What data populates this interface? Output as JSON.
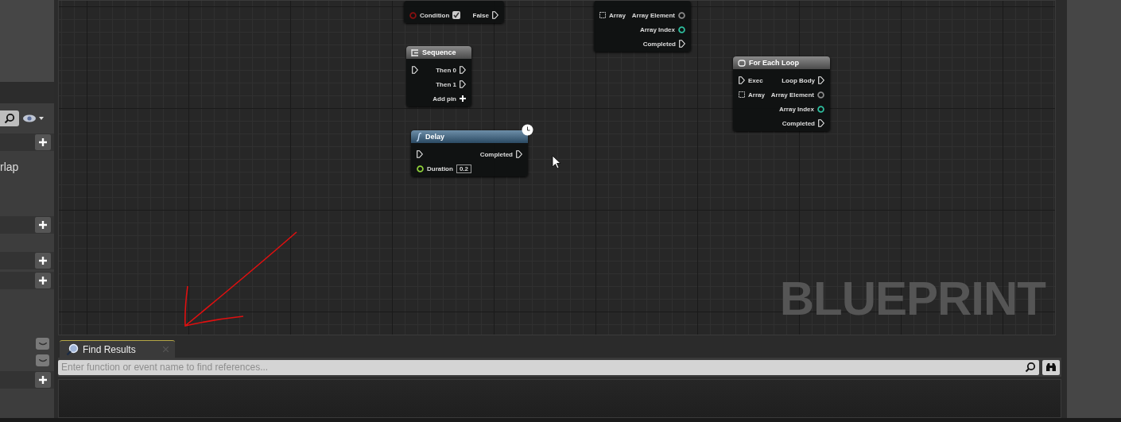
{
  "sidebar": {
    "text": "rlap"
  },
  "graph": {
    "label": "BLUEPRINT",
    "nodes": [
      {
        "kind": "plain",
        "rows": [
          {
            "in": {
              "kind": "data",
              "label": "Condition",
              "color": "#8a1010",
              "checked": true
            },
            "out": {
              "kind": "exec",
              "label": "False"
            }
          }
        ]
      },
      {
        "kind": "plain",
        "rows": [
          {
            "in": {
              "kind": "array",
              "label": "Array"
            },
            "out": {
              "kind": "data",
              "label": "Array Element",
              "color": "#8a8a8a"
            }
          },
          {
            "in": null,
            "out": {
              "kind": "data",
              "label": "Array Index",
              "color": "#2fc0a0"
            }
          },
          {
            "in": null,
            "out": {
              "kind": "exec",
              "label": "Completed"
            }
          }
        ]
      },
      {
        "kind": "sequence",
        "title": "Sequence",
        "rows": [
          {
            "in": {
              "kind": "exec"
            },
            "out": {
              "kind": "exec",
              "label": "Then 0"
            }
          },
          {
            "in": null,
            "out": {
              "kind": "exec",
              "label": "Then 1"
            }
          },
          {
            "in": null,
            "out": {
              "kind": "add",
              "label": "Add pin"
            }
          }
        ]
      },
      {
        "kind": "function",
        "title": "Delay",
        "latent": true,
        "rows": [
          {
            "in": {
              "kind": "exec"
            },
            "out": {
              "kind": "exec",
              "label": "Completed"
            }
          },
          {
            "in": {
              "kind": "data",
              "label": "Duration",
              "color": "#8fd13a",
              "value": "0.2"
            },
            "out": null
          }
        ]
      },
      {
        "kind": "loop",
        "title": "For Each Loop",
        "rows": [
          {
            "in": {
              "kind": "exec",
              "label": "Exec"
            },
            "out": {
              "kind": "exec",
              "label": "Loop Body"
            }
          },
          {
            "in": {
              "kind": "array",
              "label": "Array"
            },
            "out": {
              "kind": "data",
              "label": "Array Element",
              "color": "#8a8a8a"
            }
          },
          {
            "in": null,
            "out": {
              "kind": "data",
              "label": "Array Index",
              "color": "#2fc0a0"
            }
          },
          {
            "in": null,
            "out": {
              "kind": "exec",
              "label": "Completed"
            }
          }
        ]
      }
    ]
  },
  "find_results": {
    "tab": "Find Results",
    "placeholder": "Enter function or event name to find references..."
  }
}
